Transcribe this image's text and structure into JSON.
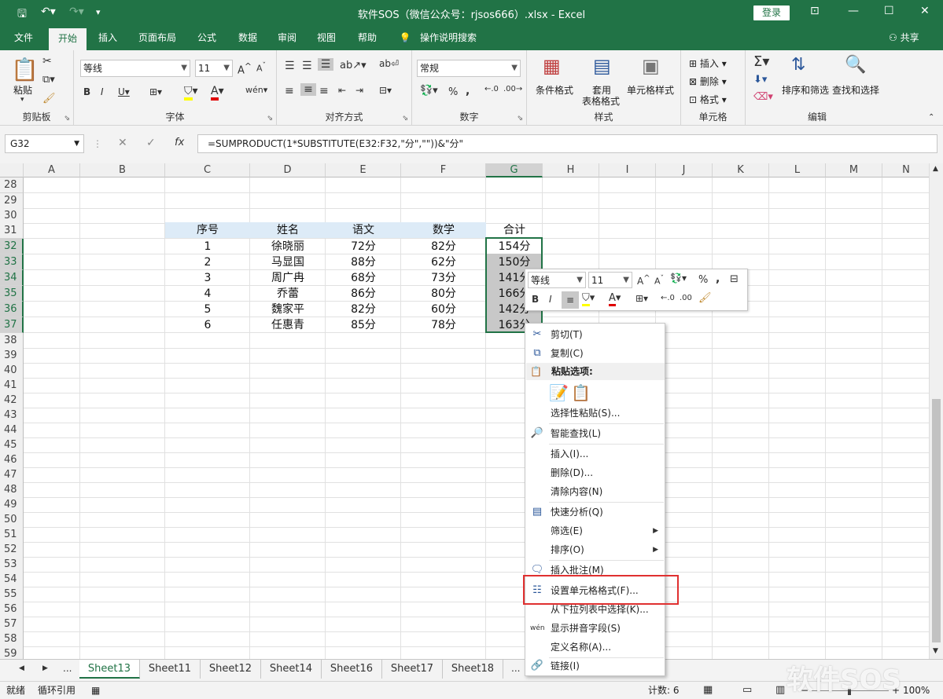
{
  "window": {
    "title": "软件SOS（微信公众号：rjsos666）.xlsx  -  Excel",
    "login_label": "登录",
    "share_label": "共享"
  },
  "ribbon_tabs": [
    "文件",
    "开始",
    "插入",
    "页面布局",
    "公式",
    "数据",
    "审阅",
    "视图",
    "帮助"
  ],
  "tell_me": "操作说明搜索",
  "groups": {
    "clipboard": {
      "label": "剪贴板",
      "paste": "粘贴"
    },
    "font": {
      "label": "字体",
      "name": "等线",
      "size": "11"
    },
    "alignment": {
      "label": "对齐方式"
    },
    "number": {
      "label": "数字",
      "format": "常规"
    },
    "styles": {
      "label": "样式",
      "cond": "条件格式",
      "table1": "套用",
      "table2": "表格格式",
      "cell": "单元格样式"
    },
    "cells": {
      "label": "单元格",
      "insert": "插入",
      "delete": "删除",
      "format": "格式"
    },
    "editing": {
      "label": "编辑",
      "sort": "排序和筛选",
      "find": "查找和选择"
    }
  },
  "name_box": "G32",
  "formula": "=SUMPRODUCT(1*SUBSTITUTE(E32:F32,\"分\",\"\"))&\"分\"",
  "columns": [
    "A",
    "B",
    "C",
    "D",
    "E",
    "F",
    "G",
    "H",
    "I",
    "J",
    "K",
    "L",
    "M",
    "N"
  ],
  "rows": [
    "28",
    "29",
    "30",
    "31",
    "32",
    "33",
    "34",
    "35",
    "36",
    "37",
    "38",
    "39",
    "40",
    "41",
    "42",
    "43",
    "44",
    "45",
    "46",
    "47",
    "48",
    "49",
    "50",
    "51",
    "52",
    "53",
    "54",
    "55",
    "56",
    "57",
    "58",
    "59"
  ],
  "table": {
    "headers": [
      "序号",
      "姓名",
      "语文",
      "数学",
      "合计"
    ],
    "rows": [
      [
        "1",
        "徐晓丽",
        "72分",
        "82分",
        "154分"
      ],
      [
        "2",
        "马显国",
        "88分",
        "62分",
        "150分"
      ],
      [
        "3",
        "周广冉",
        "68分",
        "73分",
        "141分"
      ],
      [
        "4",
        "乔蕾",
        "86分",
        "80分",
        "166分"
      ],
      [
        "5",
        "魏家平",
        "82分",
        "60分",
        "142分"
      ],
      [
        "6",
        "任惠青",
        "85分",
        "78分",
        "163分"
      ]
    ]
  },
  "mini_toolbar": {
    "font": "等线",
    "size": "11"
  },
  "context_menu": {
    "cut": "剪切(T)",
    "copy": "复制(C)",
    "paste_header": "粘贴选项:",
    "paste_special": "选择性粘贴(S)...",
    "smart_lookup": "智能查找(L)",
    "insert": "插入(I)...",
    "delete": "删除(D)...",
    "clear": "清除内容(N)",
    "quick_analysis": "快速分析(Q)",
    "filter": "筛选(E)",
    "sort": "排序(O)",
    "insert_comment": "插入批注(M)",
    "format_cells": "设置单元格格式(F)...",
    "pick_list": "从下拉列表中选择(K)...",
    "phonetic": "显示拼音字段(S)",
    "define_name": "定义名称(A)...",
    "link": "链接(I)"
  },
  "sheets": [
    "Sheet13",
    "Sheet11",
    "Sheet12",
    "Sheet14",
    "Sheet16",
    "Sheet17",
    "Sheet18"
  ],
  "sheet_more": "...",
  "status": {
    "ready": "就绪",
    "circular": "循环引用",
    "count": "计数: 6",
    "zoom": "100%"
  },
  "watermark": "软件SOS",
  "colors": {
    "excel_green": "#217346",
    "header_fill": "#ddebf7",
    "highlight": "#e03030"
  }
}
